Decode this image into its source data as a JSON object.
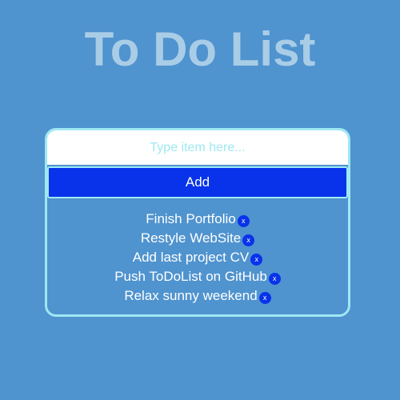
{
  "header": {
    "title": "To Do List"
  },
  "form": {
    "input_value": "",
    "input_placeholder": "Type item here...",
    "add_label": "Add"
  },
  "todos": [
    {
      "text": "Finish Portfolio",
      "remove_label": "x"
    },
    {
      "text": "Restyle WebSite",
      "remove_label": "x"
    },
    {
      "text": "Add last project CV",
      "remove_label": "x"
    },
    {
      "text": "Push ToDoList on GitHub",
      "remove_label": "x"
    },
    {
      "text": "Relax sunny weekend",
      "remove_label": "x"
    }
  ],
  "colors": {
    "background": "#4f93cf",
    "title": "#a9cde6",
    "card_border": "#9ee8f2",
    "accent": "#0833ea",
    "item_text": "#ffffff"
  }
}
